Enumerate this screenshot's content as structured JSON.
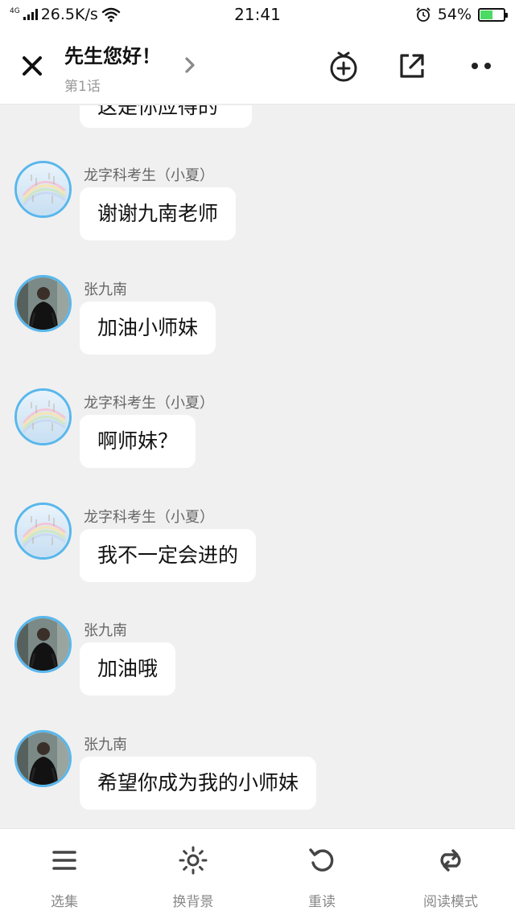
{
  "status_bar": {
    "network_type": "4G",
    "speed": "26.5K/s",
    "time": "21:41",
    "battery_percent": "54%",
    "battery_level": 0.54,
    "battery_color": "#4cd964"
  },
  "header": {
    "title": "先生您好！",
    "subtitle": "第1话",
    "icons": [
      "close-icon",
      "chevron-right-icon",
      "add-timer-icon",
      "share-icon",
      "more-icon"
    ]
  },
  "chat": {
    "partial_message": "这是你应得的",
    "messages": [
      {
        "sender": "龙字科考生（小夏）",
        "avatar": "sky-avatar",
        "text": "谢谢九南老师"
      },
      {
        "sender": "张九南",
        "avatar": "man-avatar",
        "text": "加油小师妹"
      },
      {
        "sender": "龙字科考生（小夏）",
        "avatar": "sky-avatar",
        "text": "啊师妹？"
      },
      {
        "sender": "龙字科考生（小夏）",
        "avatar": "sky-avatar",
        "text": "我不一定会进的"
      },
      {
        "sender": "张九南",
        "avatar": "man-avatar",
        "text": "加油哦"
      },
      {
        "sender": "张九南",
        "avatar": "man-avatar",
        "text": "希望你成为我的小师妹"
      }
    ]
  },
  "bottom_bar": {
    "tabs": [
      {
        "label": "选集",
        "icon": "list-icon"
      },
      {
        "label": "换背景",
        "icon": "brightness-icon"
      },
      {
        "label": "重读",
        "icon": "replay-icon"
      },
      {
        "label": "阅读模式",
        "icon": "loop-icon"
      }
    ]
  },
  "colors": {
    "background": "#f0f0f0",
    "bubble": "#ffffff",
    "avatar_ring": "#59b7ec",
    "icon": "#444444"
  }
}
